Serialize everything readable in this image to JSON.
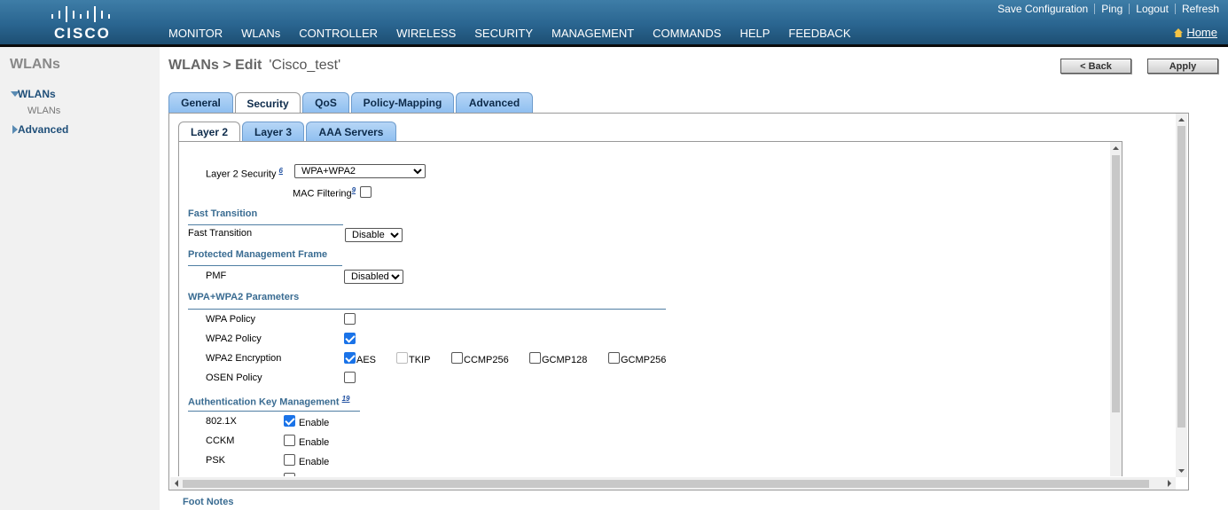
{
  "brand": {
    "logo_text": "CISCO"
  },
  "utility_links": [
    "Save Configuration",
    "Ping",
    "Logout",
    "Refresh"
  ],
  "main_nav": [
    {
      "label": "MONITOR"
    },
    {
      "label": "WLANs"
    },
    {
      "label": "CONTROLLER"
    },
    {
      "label": "WIRELESS"
    },
    {
      "label": "SECURITY"
    },
    {
      "label": "MANAGEMENT"
    },
    {
      "label": "COMMANDS"
    },
    {
      "label": "HELP"
    },
    {
      "label": "FEEDBACK"
    }
  ],
  "active_nav": "WLANs",
  "home_label": "Home",
  "sidebar": {
    "title": "WLANs",
    "items": [
      {
        "label": "WLANs",
        "expanded": true,
        "sub": "WLANs"
      },
      {
        "label": "Advanced",
        "expanded": false
      }
    ]
  },
  "page": {
    "title": "WLANs > Edit",
    "wlan_name": "'Cisco_test'",
    "back_label": "< Back",
    "apply_label": "Apply"
  },
  "tabs": [
    "General",
    "Security",
    "QoS",
    "Policy-Mapping",
    "Advanced"
  ],
  "active_tab": "Security",
  "subtabs": [
    "Layer 2",
    "Layer 3",
    "AAA Servers"
  ],
  "active_subtab": "Layer 2",
  "form": {
    "l2_security_label": "Layer 2 Security",
    "l2_security_fn": "6",
    "l2_security_value": "WPA+WPA2",
    "mac_filtering_label": "MAC Filtering",
    "mac_filtering_fn": "9",
    "mac_filtering_checked": false,
    "fast_transition_section": "Fast Transition",
    "fast_transition_label": "Fast Transition",
    "fast_transition_value": "Disable",
    "pmf_section": "Protected Management Frame",
    "pmf_label": "PMF",
    "pmf_value": "Disabled",
    "wpa_section": "WPA+WPA2 Parameters",
    "wpa_policy_label": "WPA Policy",
    "wpa_policy_checked": false,
    "wpa2_policy_label": "WPA2 Policy",
    "wpa2_policy_checked": true,
    "wpa2_enc_label": "WPA2 Encryption",
    "encryptions": [
      {
        "label": "AES",
        "checked": true,
        "disabled": false
      },
      {
        "label": "TKIP",
        "checked": false,
        "disabled": true
      },
      {
        "label": "CCMP256",
        "checked": false,
        "disabled": false
      },
      {
        "label": "GCMP128",
        "checked": false,
        "disabled": false
      },
      {
        "label": "GCMP256",
        "checked": false,
        "disabled": false
      }
    ],
    "osen_label": "OSEN Policy",
    "osen_checked": false,
    "akm_section": "Authentication Key Management",
    "akm_fn": "19",
    "akm_items": [
      {
        "label": "802.1X",
        "checked": true,
        "enable": "Enable"
      },
      {
        "label": "CCKM",
        "checked": false,
        "enable": "Enable"
      },
      {
        "label": "PSK",
        "checked": false,
        "enable": "Enable"
      }
    ]
  },
  "footnotes_label": "Foot Notes"
}
